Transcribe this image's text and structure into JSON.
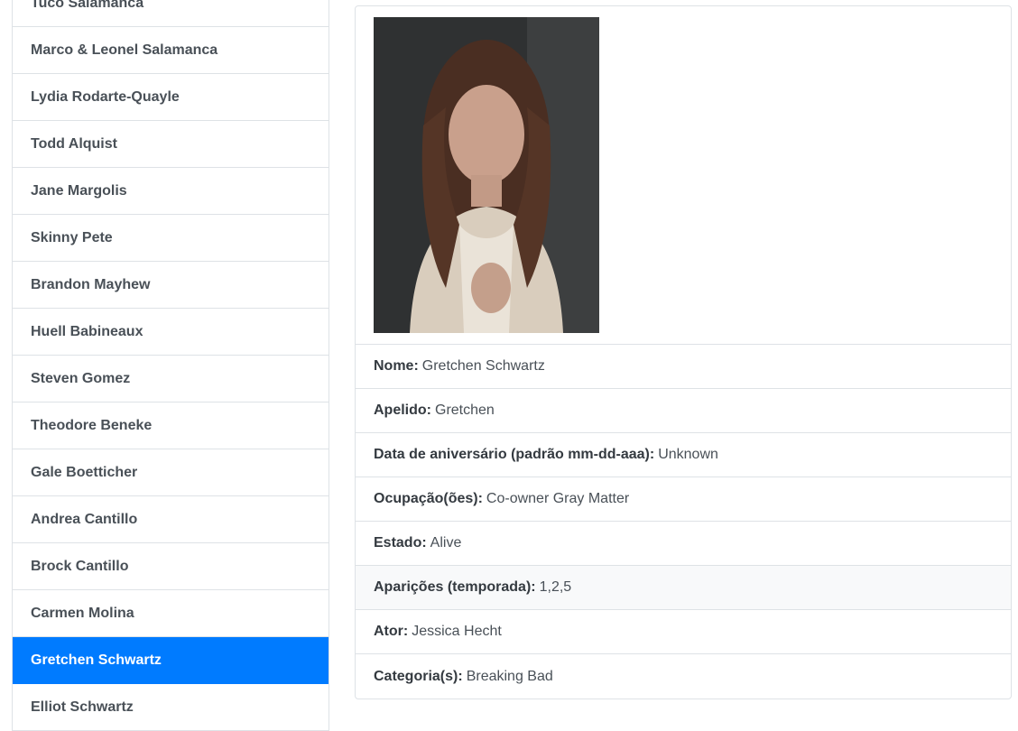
{
  "sidebar": {
    "items": [
      {
        "label": "Tuco Salamanca"
      },
      {
        "label": "Marco & Leonel Salamanca"
      },
      {
        "label": "Lydia Rodarte-Quayle"
      },
      {
        "label": "Todd Alquist"
      },
      {
        "label": "Jane Margolis"
      },
      {
        "label": "Skinny Pete"
      },
      {
        "label": "Brandon Mayhew"
      },
      {
        "label": "Huell Babineaux"
      },
      {
        "label": "Steven Gomez"
      },
      {
        "label": "Theodore Beneke"
      },
      {
        "label": "Gale Boetticher"
      },
      {
        "label": "Andrea Cantillo"
      },
      {
        "label": "Brock Cantillo"
      },
      {
        "label": "Carmen Molina"
      },
      {
        "label": "Gretchen Schwartz",
        "active": true
      },
      {
        "label": "Elliot Schwartz"
      }
    ]
  },
  "detail": {
    "photo_alt": "Gretchen Schwartz",
    "rows": [
      {
        "label": "Nome:",
        "value": "Gretchen Schwartz"
      },
      {
        "label": "Apelido:",
        "value": "Gretchen"
      },
      {
        "label": "Data de aniversário (padrão mm-dd-aaa):",
        "value": "Unknown"
      },
      {
        "label": "Ocupação(ões):",
        "value": "Co-owner Gray Matter"
      },
      {
        "label": "Estado:",
        "value": "Alive"
      },
      {
        "label": "Aparições (temporada):",
        "value": "1,2,5"
      },
      {
        "label": "Ator:",
        "value": "Jessica Hecht"
      },
      {
        "label": "Categoria(s):",
        "value": "Breaking Bad"
      }
    ]
  },
  "colors": {
    "active_bg": "#007bff",
    "border": "#dee2e6"
  }
}
